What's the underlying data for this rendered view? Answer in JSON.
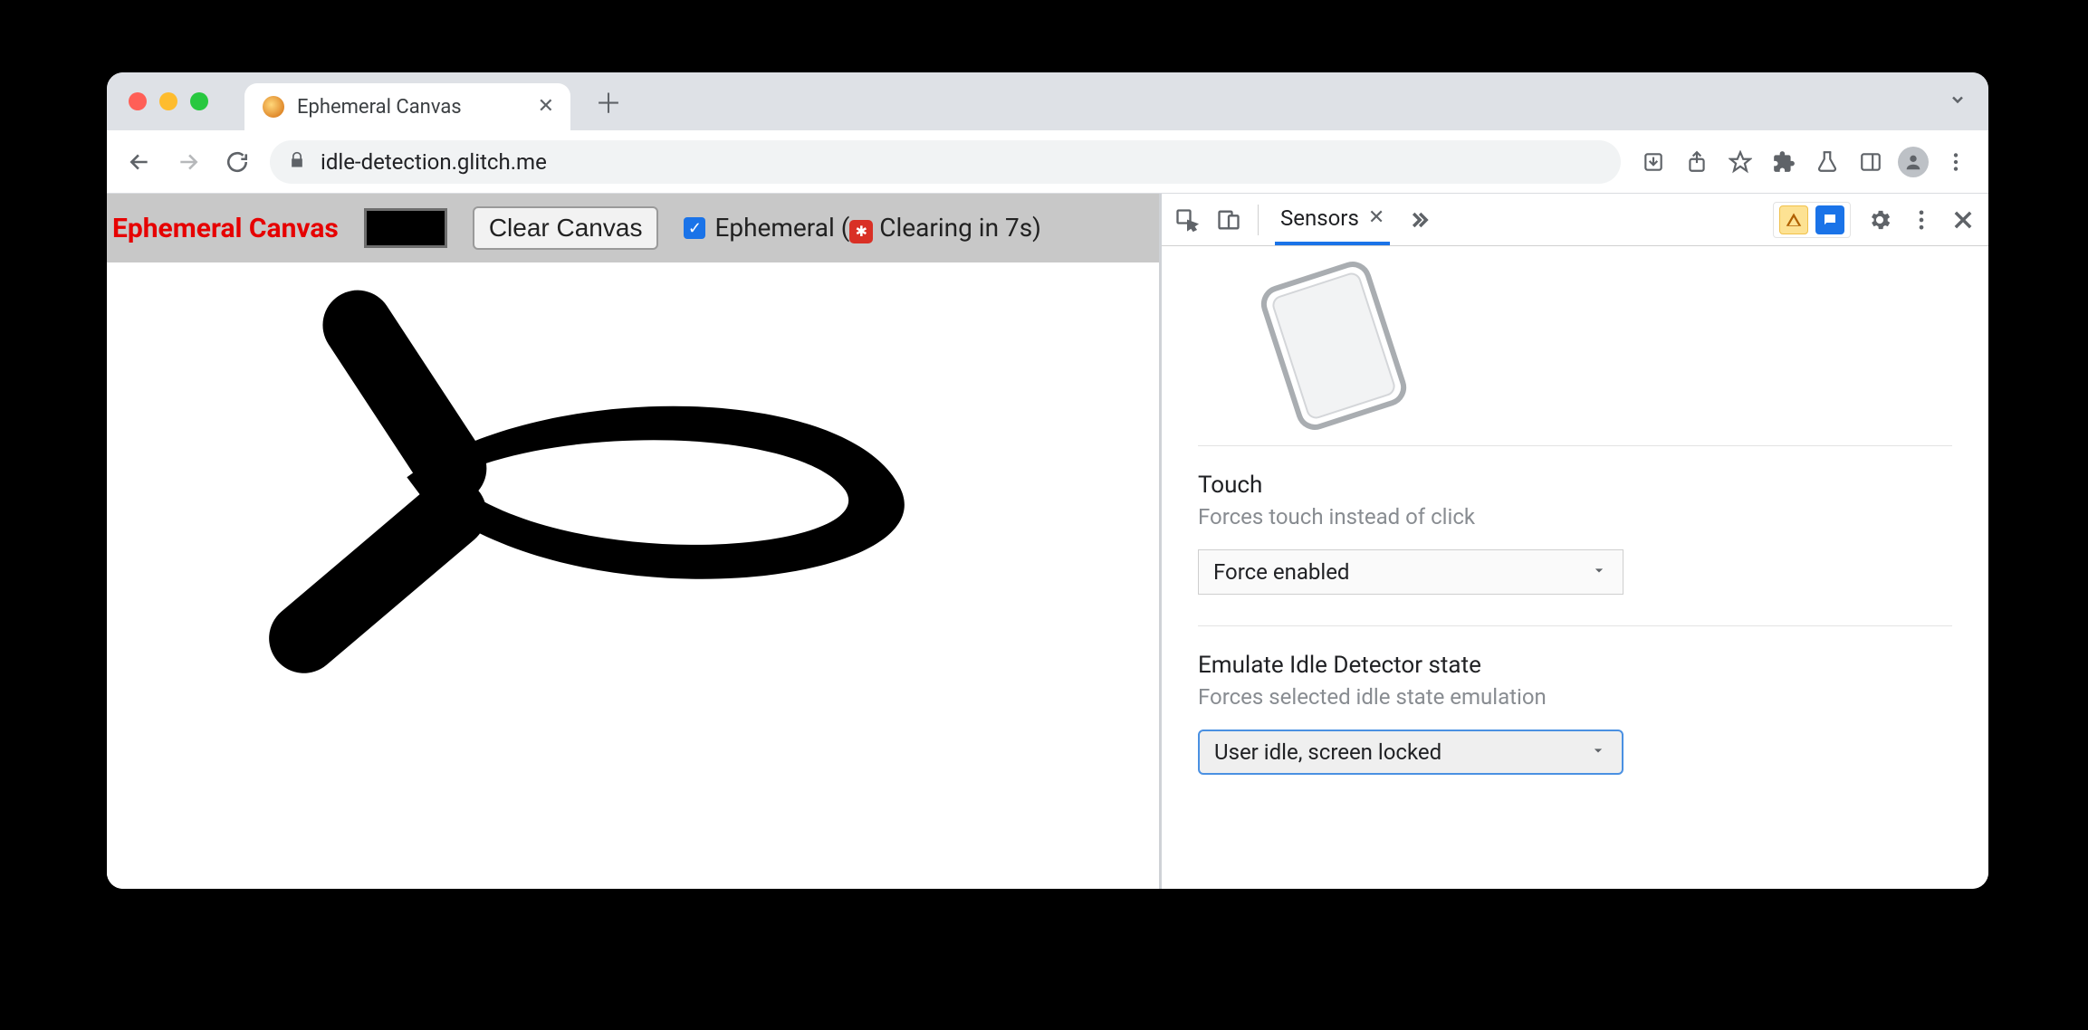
{
  "browser": {
    "tab_title": "Ephemeral Canvas",
    "url": "idle-detection.glitch.me"
  },
  "app": {
    "title": "Ephemeral Canvas",
    "clear_button": "Clear Canvas",
    "ephemeral_label_prefix": "Ephemeral (",
    "ephemeral_label_suffix": " Clearing in 7s)",
    "ephemeral_checked": true
  },
  "devtools": {
    "tab_label": "Sensors",
    "touch": {
      "title": "Touch",
      "subtitle": "Forces touch instead of click",
      "value": "Force enabled"
    },
    "idle": {
      "title": "Emulate Idle Detector state",
      "subtitle": "Forces selected idle state emulation",
      "value": "User idle, screen locked"
    }
  }
}
